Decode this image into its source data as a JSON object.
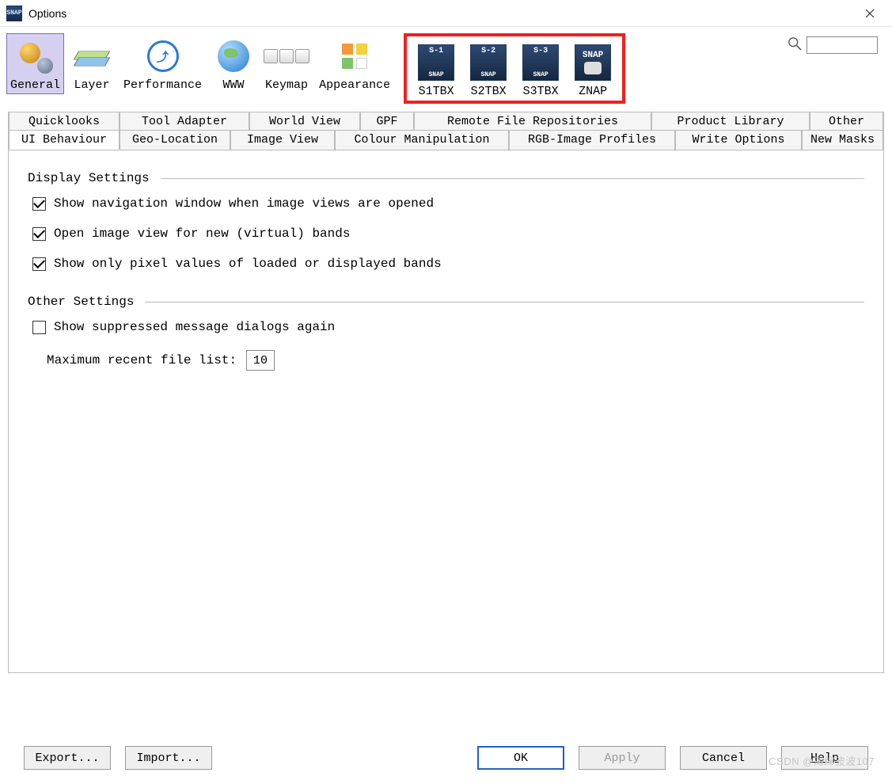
{
  "window": {
    "title": "Options"
  },
  "toolbar": {
    "categories": [
      {
        "id": "general",
        "label": "General",
        "selected": true
      },
      {
        "id": "layer",
        "label": "Layer"
      },
      {
        "id": "performance",
        "label": "Performance"
      },
      {
        "id": "www",
        "label": "WWW"
      },
      {
        "id": "keymap",
        "label": "Keymap"
      },
      {
        "id": "appearance",
        "label": "Appearance"
      }
    ],
    "highlighted": [
      {
        "id": "s1tbx",
        "label": "S1TBX",
        "badge": "S-1"
      },
      {
        "id": "s2tbx",
        "label": "S2TBX",
        "badge": "S-2"
      },
      {
        "id": "s3tbx",
        "label": "S3TBX",
        "badge": "S-3"
      },
      {
        "id": "znap",
        "label": "ZNAP",
        "badge": "SNAP"
      }
    ],
    "search_placeholder": ""
  },
  "tabs": {
    "row1": [
      "Quicklooks",
      "Tool Adapter",
      "World View",
      "GPF",
      "Remote File Repositories",
      "Product Library",
      "Other"
    ],
    "row2": [
      "UI Behaviour",
      "Geo-Location",
      "Image View",
      "Colour Manipulation",
      "RGB-Image Profiles",
      "Write Options",
      "New Masks"
    ],
    "active": "UI Behaviour"
  },
  "panel": {
    "group1_title": "Display Settings",
    "group2_title": "Other Settings",
    "checks": {
      "nav_window": {
        "label": "Show navigation window when image views are opened",
        "checked": true
      },
      "open_view": {
        "label": "Open image view for new (virtual) bands",
        "checked": true
      },
      "pixel_values": {
        "label": "Show only pixel values of loaded or displayed bands",
        "checked": true
      },
      "suppressed": {
        "label": "Show suppressed message dialogs again",
        "checked": false
      }
    },
    "max_recent_label": "Maximum recent file list:",
    "max_recent_value": "10"
  },
  "buttons": {
    "export": "Export...",
    "import": "Import...",
    "ok": "OK",
    "apply": "Apply",
    "cancel": "Cancel",
    "help": "Help"
  },
  "watermark": "CSDN @海绵波波107"
}
